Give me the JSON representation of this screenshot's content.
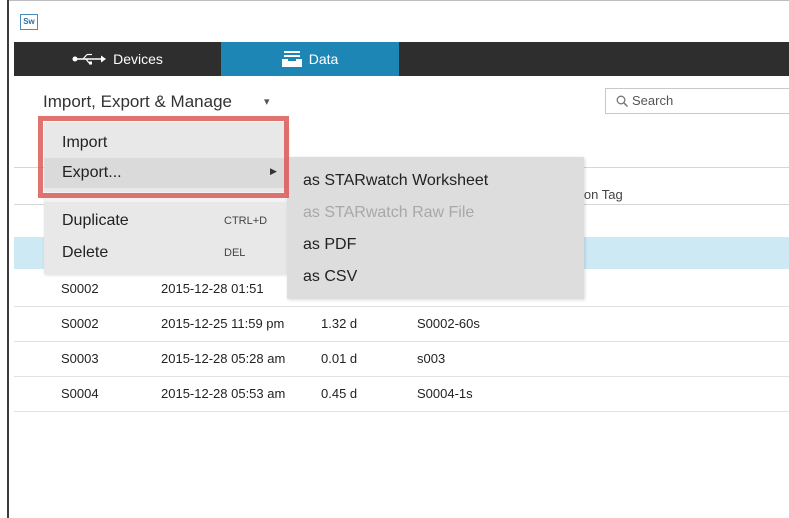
{
  "app": {
    "icon_text": "Sw"
  },
  "tabs": [
    {
      "label": "Devices",
      "icon": "usb-icon",
      "active": false
    },
    {
      "label": "Data",
      "icon": "tray-icon",
      "active": true
    }
  ],
  "toolbar": {
    "menu_title": "Import, Export & Manage",
    "caret": "▾"
  },
  "search": {
    "placeholder": "Search"
  },
  "table": {
    "partial_header": "ssion Tag",
    "rows": [
      {
        "id": "S0002",
        "date": "2015-12-28 01:51",
        "duration": "",
        "tag": ""
      },
      {
        "id": "S0002",
        "date": "2015-12-25 11:59 pm",
        "duration": "1.32 d",
        "tag": "S0002-60s"
      },
      {
        "id": "S0003",
        "date": "2015-12-28 05:28 am",
        "duration": "0.01 d",
        "tag": "s003"
      },
      {
        "id": "S0004",
        "date": "2015-12-28 05:53 am",
        "duration": "0.45 d",
        "tag": "S0004-1s"
      }
    ]
  },
  "menu": {
    "import": "Import",
    "export": "Export...",
    "duplicate": "Duplicate",
    "duplicate_shortcut": "CTRL+D",
    "delete": "Delete",
    "delete_shortcut": "DEL"
  },
  "submenu": {
    "items": [
      {
        "label": "as STARwatch Worksheet",
        "enabled": true
      },
      {
        "label": "as STARwatch Raw File",
        "enabled": false
      },
      {
        "label": "as PDF",
        "enabled": true
      },
      {
        "label": "as CSV",
        "enabled": true
      }
    ]
  },
  "colors": {
    "accent": "#1e86b5",
    "highlight": "#d9534f",
    "selected_row": "#cce9f4"
  }
}
